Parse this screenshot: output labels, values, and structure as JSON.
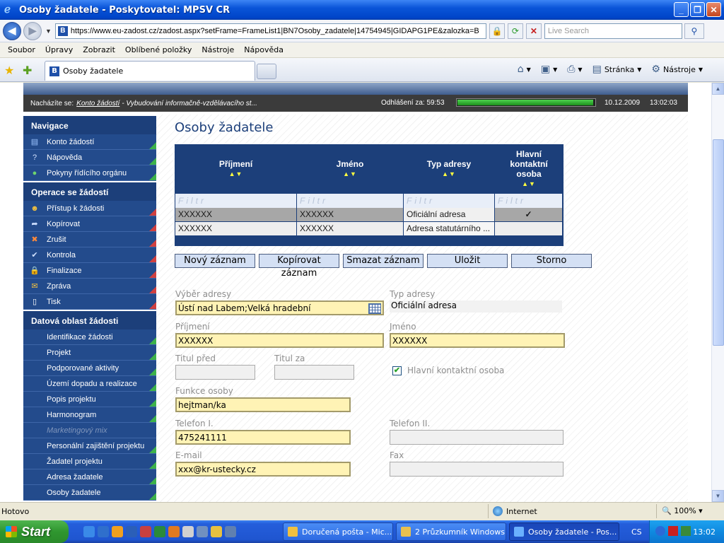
{
  "window": {
    "title": "Osoby žadatele - Poskytovatel: MPSV CR"
  },
  "address_bar": {
    "url": "https://www.eu-zadost.cz/zadost.aspx?setFrame=FrameList1|BN7Osoby_zadatele|14754945|GIDAPG1PE&zalozka=B",
    "search_placeholder": "Live Search"
  },
  "menu": [
    "Soubor",
    "Úpravy",
    "Zobrazit",
    "Oblíbené položky",
    "Nástroje",
    "Nápověda"
  ],
  "tab": {
    "label": "Osoby žadatele"
  },
  "command_bar": {
    "page_label": "Stránka",
    "tools_label": "Nástroje"
  },
  "info_bar": {
    "location_prefix": "Nacházíte se:",
    "location_link": "Konto žádostí",
    "location_rest": "- Vybudování informačně-vzdělávacího st...",
    "logout_label": "Odhlášení za:",
    "logout_time": "59:53",
    "logout_progress": 0.99,
    "date": "10.12.2009",
    "time": "13:02:03"
  },
  "sidebar": {
    "nav_header": "Navigace",
    "nav_items": [
      {
        "label": "Konto žádostí",
        "icon": "list-icon"
      },
      {
        "label": "Nápověda",
        "icon": "help-icon"
      },
      {
        "label": "Pokyny řídícího orgánu",
        "icon": "globe-icon"
      }
    ],
    "ops_header": "Operace se žádostí",
    "ops_items": [
      {
        "label": "Přístup k žádosti",
        "icon": "users-icon"
      },
      {
        "label": "Kopírovat",
        "icon": "arrow-icon"
      },
      {
        "label": "Zrušit",
        "icon": "cross-icon"
      },
      {
        "label": "Kontrola",
        "icon": "check-icon"
      },
      {
        "label": "Finalizace",
        "icon": "lock-icon"
      },
      {
        "label": "Zpráva",
        "icon": "envelope-icon"
      },
      {
        "label": "Tisk",
        "icon": "document-icon"
      }
    ],
    "data_header": "Datová oblast žádosti",
    "data_items": [
      "Identifikace žádosti",
      "Projekt",
      "Podporované aktivity",
      "Území dopadu a realizace",
      "Popis projektu",
      "Harmonogram",
      "Marketingový mix",
      "Personální zajištění projektu",
      "Žadatel projektu",
      "Adresa žadatele",
      "Osoby žadatele"
    ]
  },
  "main": {
    "title": "Osoby žadatele",
    "grid": {
      "columns": [
        "Příjmení",
        "Jméno",
        "Typ adresy",
        "Hlavní kontaktní osoba"
      ],
      "sort_glyph": "▲▼",
      "filter_placeholder": "Filtr",
      "rows": [
        {
          "prijmeni": "XXXXXX",
          "jmeno": "XXXXXX",
          "typ": "Oficiální adresa",
          "hlavni": "✓"
        },
        {
          "prijmeni": "XXXXXX",
          "jmeno": "XXXXXX",
          "typ": "Adresa statutárního ...",
          "hlavni": ""
        }
      ]
    },
    "buttons": {
      "new": "Nový záznam",
      "copy": "Kopírovat záznam",
      "delete": "Smazat záznam",
      "save": "Uložit",
      "cancel": "Storno"
    },
    "form": {
      "vyber_adresy_label": "Výběr adresy",
      "vyber_adresy_value": "Ústí nad Labem;Velká hradební",
      "typ_adresy_label": "Typ adresy",
      "typ_adresy_value": "Oficiální adresa",
      "prijmeni_label": "Příjmení",
      "prijmeni_value": "XXXXXX",
      "jmeno_label": "Jméno",
      "jmeno_value": "XXXXXX",
      "titul_pred_label": "Titul před",
      "titul_pred_value": "",
      "titul_za_label": "Titul za",
      "titul_za_value": "",
      "hlavni_label": "Hlavní kontaktní osoba",
      "hlavni_checked": true,
      "funkce_label": "Funkce osoby",
      "funkce_value": "hejtman/ka",
      "telefon1_label": "Telefon I.",
      "telefon1_value": "475241111",
      "telefon2_label": "Telefon II.",
      "telefon2_value": "",
      "email_label": "E-mail",
      "email_value": "xxx@kr-ustecky.cz",
      "fax_label": "Fax",
      "fax_value": ""
    }
  },
  "status_bar": {
    "status": "Hotovo",
    "zone": "Internet",
    "zoom": "100%"
  },
  "taskbar": {
    "start": "Start",
    "tasks": [
      {
        "label": "Doručená pošta - Mic..."
      },
      {
        "label": "2 Průzkumník Windows"
      },
      {
        "label": "Osoby žadatele - Pos..."
      }
    ],
    "language": "CS",
    "clock": "13:02"
  }
}
